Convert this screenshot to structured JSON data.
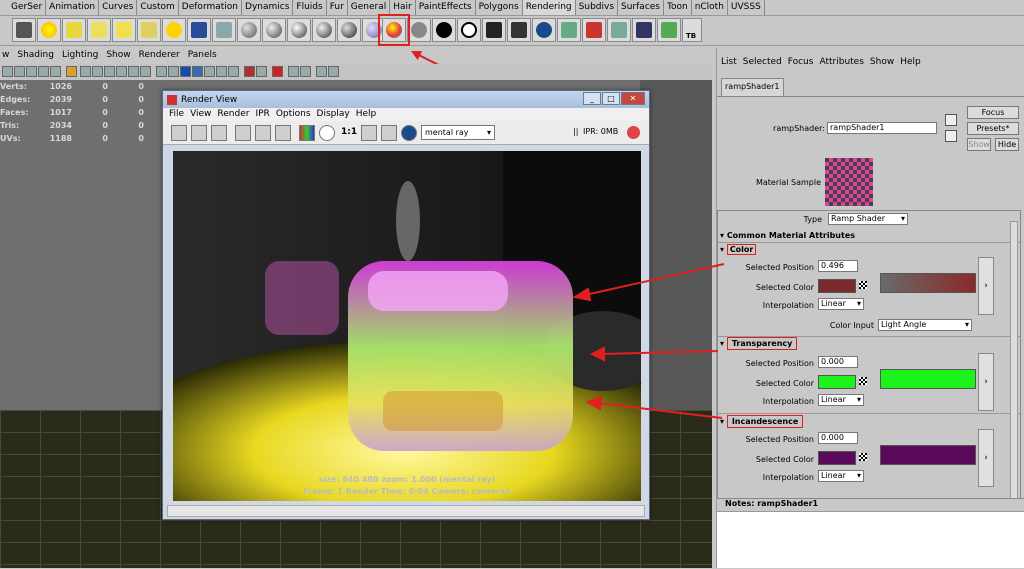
{
  "shelf": {
    "tabs": [
      "GerSer",
      "Animation",
      "Curves",
      "Custom",
      "Deformation",
      "Dynamics",
      "Fluids",
      "Fur",
      "General",
      "Hair",
      "PaintEffects",
      "Polygons",
      "Rendering",
      "Subdivs",
      "Surfaces",
      "Toon",
      "nCloth",
      "UVSSS"
    ],
    "active_tab": "Rendering",
    "tb_label": "TB"
  },
  "viewport": {
    "menu": [
      "w",
      "Shading",
      "Lighting",
      "Show",
      "Renderer",
      "Panels"
    ],
    "hud": [
      {
        "label": "Verts:",
        "value": "1026",
        "a": "0",
        "b": "0"
      },
      {
        "label": "Edges:",
        "value": "2039",
        "a": "0",
        "b": "0"
      },
      {
        "label": "Faces:",
        "value": "1017",
        "a": "0",
        "b": "0"
      },
      {
        "label": "Tris:",
        "value": "2034",
        "a": "0",
        "b": "0"
      },
      {
        "label": "UVs:",
        "value": "1188",
        "a": "0",
        "b": "0"
      }
    ]
  },
  "render_view": {
    "title": "Render View",
    "window_buttons": [
      "_",
      "□",
      "✕"
    ],
    "menu": [
      "File",
      "View",
      "Render",
      "IPR",
      "Options",
      "Display",
      "Help"
    ],
    "ratio": "1:1",
    "renderer": "mental ray",
    "ipr_label": "IPR: 0MB",
    "info_line1": "size:  640  480  zoom: 1.000          (mental ray)",
    "info_line2": "Frame: 1      Render Time: 0:04      Camera: camera1"
  },
  "attribute_editor": {
    "menu": [
      "List",
      "Selected",
      "Focus",
      "Attributes",
      "Show",
      "Help"
    ],
    "node_tab": "rampShader1",
    "node_label": "rampShader:",
    "node_name": "rampShader1",
    "focus": "Focus",
    "presets": "Presets*",
    "show": "Show",
    "hide": "Hide",
    "material_sample": "Material Sample",
    "type_label": "Type",
    "type_value": "Ramp Shader",
    "common_header": "Common Material Attributes",
    "sections": [
      {
        "name": "Color",
        "selected_position": "0.496",
        "swatch": "#7a2a2a",
        "ramp_from": "#6a6a6a",
        "ramp_to": "#8a2a2a",
        "interpolation": "Linear"
      },
      {
        "name": "Transparency",
        "selected_position": "0.000",
        "swatch": "#1cf21c",
        "ramp_from": "#1cf21c",
        "ramp_to": "#1cf21c",
        "interpolation": "Linear"
      },
      {
        "name": "Incandescence",
        "selected_position": "0.000",
        "swatch": "#5a0a5a",
        "ramp_from": "#5a0a5a",
        "ramp_to": "#5a0a5a",
        "interpolation": "Linear"
      }
    ],
    "labels": {
      "selected_position": "Selected Position",
      "selected_color": "Selected Color",
      "interpolation": "Interpolation",
      "color_input": "Color Input"
    },
    "color_input_value": "Light Angle",
    "notes_label": "Notes:  rampShader1"
  },
  "accent_colors": {
    "annotation": "#e02020",
    "ramp_shader_icon": "#e83a3a"
  }
}
